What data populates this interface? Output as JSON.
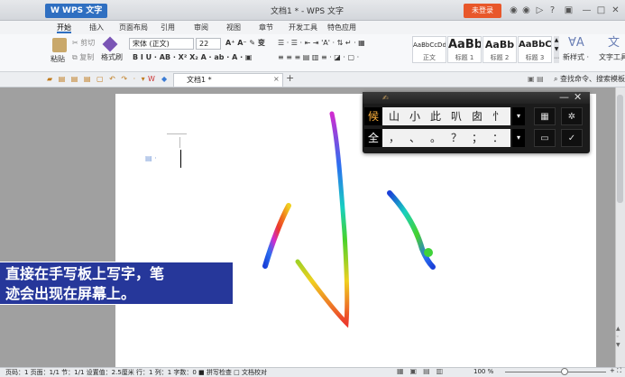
{
  "app": {
    "name": "W WPS 文字",
    "doc_title": "文档1 * - WPS 文字",
    "login": "未登录",
    "window_controls": [
      "—",
      "□",
      "✕"
    ]
  },
  "menu": [
    "开始",
    "插入",
    "页面布局",
    "引用",
    "审阅",
    "视图",
    "章节",
    "开发工具",
    "特色应用"
  ],
  "ribbon": {
    "paste": "粘贴",
    "cut": "剪切",
    "copy": "复制",
    "format_painter": "格式刷",
    "font_name": "宋体 (正文)",
    "font_size": "22",
    "styles": [
      {
        "preview": "AaBbCcDd",
        "name": "正文"
      },
      {
        "preview": "AaBb",
        "name": "标题 1"
      },
      {
        "preview": "AaBb",
        "name": "标题 2"
      },
      {
        "preview": "AaBbC",
        "name": "标题 3"
      }
    ],
    "new_style": "新样式",
    "text_tool": "文字工具"
  },
  "tabbar": {
    "doc_tab": "文档1 *",
    "find": "查找命令、搜索模板"
  },
  "ime": {
    "row1_lead": "候",
    "candidates": [
      "山",
      "小",
      "此",
      "叭",
      "囱",
      "忄"
    ],
    "row2_lead": "全",
    "punct": [
      "，",
      "、",
      "。",
      "？",
      "；",
      "："
    ]
  },
  "overlay": {
    "line1": "直接在手写板上写字，笔",
    "line2": "迹会出现在屏幕上。"
  },
  "status": {
    "text": "页码：1  页面：1/1  节：1/1  设置值：2.5厘米  行：1  列：1  字数：0  ■ 拼写检查  □ 文档校对",
    "zoom": "100 %"
  }
}
